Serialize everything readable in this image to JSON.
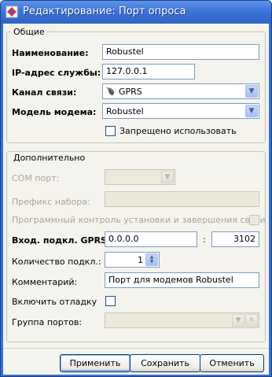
{
  "window": {
    "title": "Редактирование:  Порт опроса"
  },
  "general": {
    "group_title": "Общие",
    "name_label": "Наименование:",
    "name_value": "Robustel",
    "ip_label": "IP-адрес службы:",
    "ip_value": "127.0.0.1",
    "channel_label": "Канал связи:",
    "channel_value": "GPRS",
    "channel_icon": "mouse-icon",
    "modem_label": "Модель модема:",
    "modem_value": "Robustel",
    "forbid_label": "Запрещено использовать",
    "forbid_checked": false
  },
  "extra": {
    "group_title": "Дополнительно",
    "com_label": "COM порт:",
    "com_value": "",
    "prefix_label": "Префикс набора:",
    "prefix_value": "",
    "program_control_label": "Программный контроль установки и завершения связи",
    "gprs_label": "Вход. подкл. GPRS:",
    "gprs_ip": "0.0.0.0",
    "gprs_colon": ":",
    "gprs_port": "3102",
    "count_label": "Количество подкл.:",
    "count_value": "1",
    "comment_label": "Комментарий:",
    "comment_value": "Порт для модемов Robustel",
    "debug_label": "Включить отладку",
    "group_label": "Группа портов:",
    "group_value": ""
  },
  "buttons": {
    "apply": "Применить",
    "save": "Сохранить",
    "cancel": "Отменить"
  },
  "colors": {
    "titlebar": "#3d74d8",
    "client_bg": "#f4f3ee",
    "input_border": "#7f9db9"
  }
}
